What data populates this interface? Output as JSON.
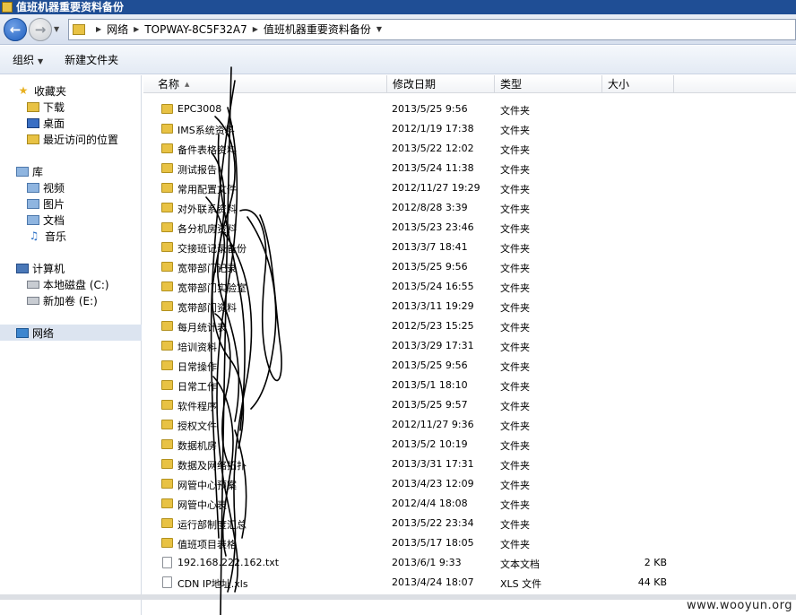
{
  "window": {
    "title": "值班机器重要资料备份"
  },
  "address": {
    "crumbs": [
      "网络",
      "TOPWAY-8C5F32A7",
      "值班机器重要资料备份"
    ]
  },
  "toolbar": {
    "organize": "组织",
    "new_folder": "新建文件夹"
  },
  "nav": {
    "favorites": {
      "label": "收藏夹",
      "items": [
        "下载",
        "桌面",
        "最近访问的位置"
      ]
    },
    "libraries": {
      "label": "库",
      "items": [
        "视频",
        "图片",
        "文档",
        "音乐"
      ]
    },
    "computer": {
      "label": "计算机",
      "items": [
        "本地磁盘 (C:)",
        "新加卷 (E:)"
      ]
    },
    "network": {
      "label": "网络"
    }
  },
  "columns": {
    "name": "名称",
    "modified": "修改日期",
    "type": "类型",
    "size": "大小"
  },
  "files": [
    {
      "name": "EPC3008",
      "date": "2013/5/25 9:56",
      "type": "文件夹",
      "size": "",
      "kind": "folder"
    },
    {
      "name": "IMS系统资料",
      "date": "2012/1/19 17:38",
      "type": "文件夹",
      "size": "",
      "kind": "folder"
    },
    {
      "name": "备件表格资料",
      "date": "2013/5/22 12:02",
      "type": "文件夹",
      "size": "",
      "kind": "folder"
    },
    {
      "name": "测试报告",
      "date": "2013/5/24 11:38",
      "type": "文件夹",
      "size": "",
      "kind": "folder"
    },
    {
      "name": "常用配置文件",
      "date": "2012/11/27 19:29",
      "type": "文件夹",
      "size": "",
      "kind": "folder"
    },
    {
      "name": "对外联系资料",
      "date": "2012/8/28 3:39",
      "type": "文件夹",
      "size": "",
      "kind": "folder"
    },
    {
      "name": "各分机房资料",
      "date": "2013/5/23 23:46",
      "type": "文件夹",
      "size": "",
      "kind": "folder"
    },
    {
      "name": "交接班记录备份",
      "date": "2013/3/7 18:41",
      "type": "文件夹",
      "size": "",
      "kind": "folder"
    },
    {
      "name": "宽带部门记录",
      "date": "2013/5/25 9:56",
      "type": "文件夹",
      "size": "",
      "kind": "folder"
    },
    {
      "name": "宽带部门实验室",
      "date": "2013/5/24 16:55",
      "type": "文件夹",
      "size": "",
      "kind": "folder"
    },
    {
      "name": "宽带部门资料",
      "date": "2013/3/11 19:29",
      "type": "文件夹",
      "size": "",
      "kind": "folder"
    },
    {
      "name": "每月统计表",
      "date": "2012/5/23 15:25",
      "type": "文件夹",
      "size": "",
      "kind": "folder"
    },
    {
      "name": "培训资料",
      "date": "2013/3/29 17:31",
      "type": "文件夹",
      "size": "",
      "kind": "folder"
    },
    {
      "name": "日常操作",
      "date": "2013/5/25 9:56",
      "type": "文件夹",
      "size": "",
      "kind": "folder"
    },
    {
      "name": "日常工作",
      "date": "2013/5/1 18:10",
      "type": "文件夹",
      "size": "",
      "kind": "folder"
    },
    {
      "name": "软件程序",
      "date": "2013/5/25 9:57",
      "type": "文件夹",
      "size": "",
      "kind": "folder"
    },
    {
      "name": "授权文件",
      "date": "2012/11/27 9:36",
      "type": "文件夹",
      "size": "",
      "kind": "folder"
    },
    {
      "name": "数据机房",
      "date": "2013/5/2 10:19",
      "type": "文件夹",
      "size": "",
      "kind": "folder"
    },
    {
      "name": "数据及网络拓扑",
      "date": "2013/3/31 17:31",
      "type": "文件夹",
      "size": "",
      "kind": "folder"
    },
    {
      "name": "网管中心预案",
      "date": "2013/4/23 12:09",
      "type": "文件夹",
      "size": "",
      "kind": "folder"
    },
    {
      "name": "网管中心表",
      "date": "2012/4/4 18:08",
      "type": "文件夹",
      "size": "",
      "kind": "folder"
    },
    {
      "name": "运行部制度汇总",
      "date": "2013/5/22 23:34",
      "type": "文件夹",
      "size": "",
      "kind": "folder"
    },
    {
      "name": "值班项目表格",
      "date": "2013/5/17 18:05",
      "type": "文件夹",
      "size": "",
      "kind": "folder"
    },
    {
      "name": "192.168.222.162.txt",
      "date": "2013/6/1 9:33",
      "type": "文本文档",
      "size": "2 KB",
      "kind": "file"
    },
    {
      "name": "CDN IP地址.xls",
      "date": "2013/4/24 18:07",
      "type": "XLS 文件",
      "size": "44 KB",
      "kind": "file"
    }
  ],
  "watermark": "www.wooyun.org"
}
